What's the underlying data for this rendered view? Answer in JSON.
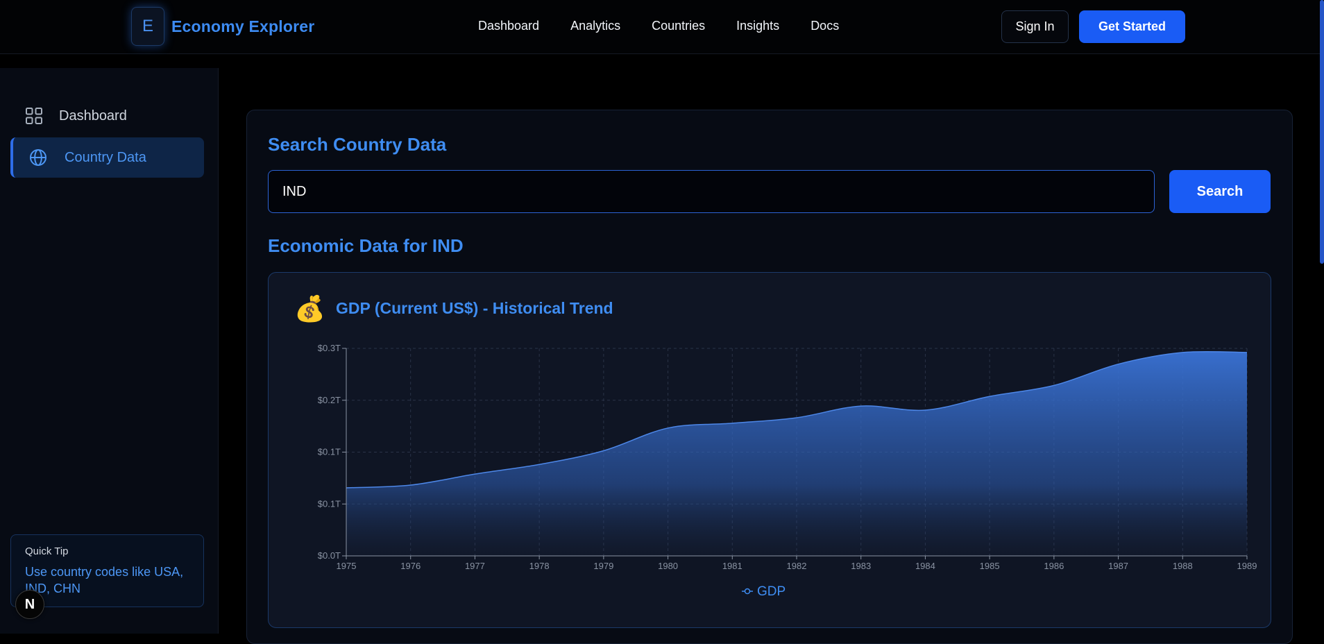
{
  "header": {
    "brand_letter": "E",
    "brand_name": "Economy Explorer",
    "nav": [
      "Dashboard",
      "Analytics",
      "Countries",
      "Insights",
      "Docs"
    ],
    "sign_in": "Sign In",
    "get_started": "Get Started"
  },
  "sidebar": {
    "items": [
      {
        "label": "Dashboard",
        "icon": "grid-icon"
      },
      {
        "label": "Country Data",
        "icon": "globe-icon"
      }
    ],
    "tip_title": "Quick Tip",
    "tip_text": "Use country codes like USA, IND, CHN",
    "badge_letter": "N"
  },
  "main": {
    "search_title": "Search Country Data",
    "search_value": "IND",
    "search_button": "Search",
    "economic_title": "Economic Data for IND",
    "chart_emoji": "💰",
    "chart_title": "GDP (Current US$) - Historical Trend"
  },
  "colors": {
    "accent": "#3f8df2",
    "primary_button": "#1a5cf5",
    "background": "#000000",
    "panel": "#070b14",
    "chart_fill": "#3a73d6"
  },
  "chart_data": {
    "type": "area",
    "title": "GDP (Current US$) - Historical Trend",
    "x": [
      1975,
      1976,
      1977,
      1978,
      1979,
      1980,
      1981,
      1982,
      1983,
      1984,
      1985,
      1986,
      1987,
      1988,
      1989
    ],
    "series": [
      {
        "name": "GDP",
        "unit": "trillion US$",
        "values": [
          0.099,
          0.103,
          0.119,
          0.133,
          0.153,
          0.186,
          0.193,
          0.201,
          0.218,
          0.212,
          0.232,
          0.248,
          0.279,
          0.296,
          0.296
        ]
      }
    ],
    "y_ticks": [
      "$0.0T",
      "$0.1T",
      "$0.1T",
      "$0.2T",
      "$0.3T"
    ],
    "y_tick_values": [
      0,
      0.05,
      0.1,
      0.15,
      0.2
    ],
    "ylim": [
      0,
      0.2
    ],
    "xlabel": "",
    "ylabel": "",
    "grid": true,
    "legend_position": "bottom"
  }
}
